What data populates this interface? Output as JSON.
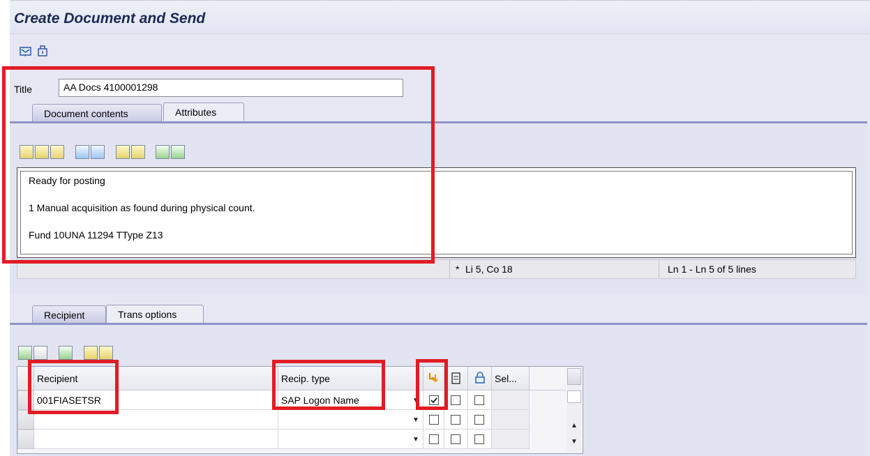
{
  "window": {
    "title": "Create Document and Send"
  },
  "toolbar": {
    "icons": [
      "send-icon",
      "attachment-icon"
    ]
  },
  "document": {
    "title_label": "Title",
    "title_value": "AA Docs 4100001298",
    "tabs": [
      {
        "label": "Document contents",
        "active": true
      },
      {
        "label": "Attributes",
        "active": false
      }
    ],
    "editor_tools": [
      "cut-icon",
      "copy-icon",
      "paste-icon",
      "undo-icon",
      "redo-icon",
      "find-icon",
      "find-next-icon",
      "import-icon",
      "export-icon"
    ],
    "lines": [
      "Ready for posting",
      "1 Manual acquisition as found during physical count.",
      "Fund 10UNA 11294 TType Z13"
    ],
    "status": {
      "marker": "*",
      "position": "Li 5, Co 18",
      "range": "Ln 1 - Ln 5 of 5 lines"
    }
  },
  "recipient": {
    "tabs": [
      {
        "label": "Recipient",
        "active": true
      },
      {
        "label": "Trans options",
        "active": false
      }
    ],
    "grid_tools": [
      "insert-row-icon",
      "append-row-icon",
      "delete-row-icon",
      "hierarchy-up-icon",
      "hierarchy-down-icon"
    ],
    "columns": {
      "recipient": "Recipient",
      "recip_type": "Recip. type",
      "express": "express-icon",
      "copy": "copy-icon",
      "lock": "lock-icon",
      "sel": "Sel..."
    },
    "rows": [
      {
        "recipient": "001FIASETSR",
        "recip_type": "SAP Logon Name",
        "express": true,
        "copy": false,
        "lock": false
      },
      {
        "recipient": "",
        "recip_type": "",
        "express": false,
        "copy": false,
        "lock": false
      },
      {
        "recipient": "",
        "recip_type": "",
        "express": false,
        "copy": false,
        "lock": false
      }
    ]
  },
  "colors": {
    "highlight": "#e01c24",
    "tab_panel": "#8f93c8",
    "header_text": "#1b2a55"
  }
}
